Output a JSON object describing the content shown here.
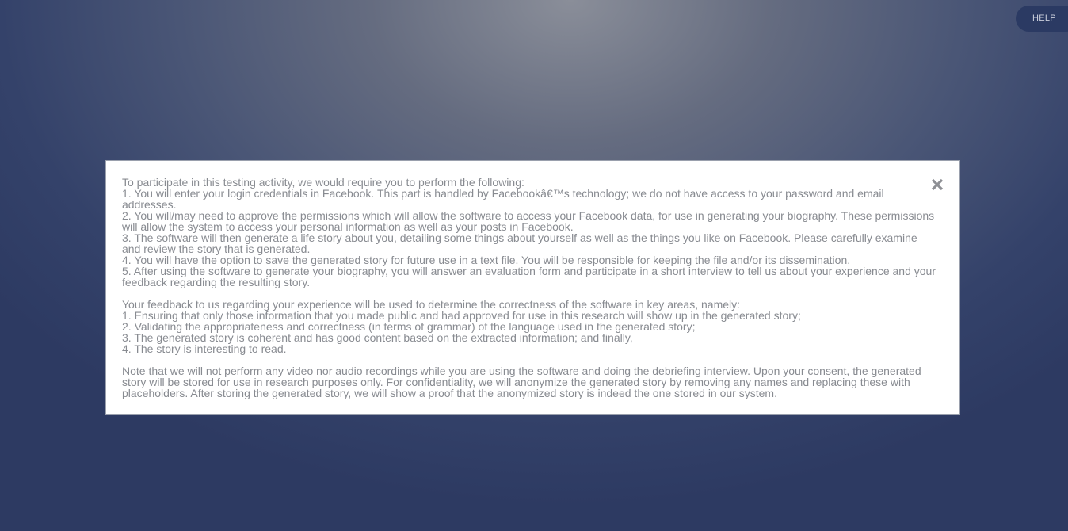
{
  "help_button": {
    "label": "HELP"
  },
  "modal": {
    "close_icon": "close-icon",
    "paragraphs": [
      {
        "lines": [
          "To participate in this testing activity, we would require you to perform the following:",
          "1. You will enter your login credentials in Facebook. This part is handled by Facebookâ€™s technology; we do not have access to your password and email addresses.",
          "2. You will/may need to approve the permissions which will allow the software to access your Facebook data, for use in generating your biography. These permissions will allow the system to access your personal information as well as your posts in Facebook.",
          "3. The software will then generate a life story about you, detailing some things about yourself as well as the things you like on Facebook. Please carefully examine and review the story that is generated.",
          "4. You will have the option to save the generated story for future use in a text file. You will be responsible for keeping the file and/or its dissemination.",
          "5. After using the software to generate your biography, you will answer an evaluation form and participate in a short interview to tell us about your experience and your feedback regarding the resulting story."
        ]
      },
      {
        "lines": [
          "Your feedback to us regarding your experience will be used to determine the correctness of the software in key areas, namely:",
          "1. Ensuring that only those information that you made public and had approved for use in this research will show up in the generated story;",
          "2. Validating the appropriateness and correctness (in terms of grammar) of the language used in the generated story;",
          "3. The generated story is coherent and has good content based on the extracted information; and finally,",
          "4. The story is interesting to read."
        ]
      },
      {
        "lines": [
          "Note that we will not perform any video nor audio recordings while you are using the software and doing the debriefing interview. Upon your consent, the generated story will be stored for use in research purposes only. For confidentiality, we will anonymize the generated story by removing any names and replacing these with placeholders. After storing the generated story, we will show a proof that the anonymized story is indeed the one stored in our system."
        ]
      }
    ]
  },
  "colors": {
    "modal_text": "#888b91",
    "help_button_bg": "#2b3a63",
    "close_icon": "#8e9095"
  }
}
